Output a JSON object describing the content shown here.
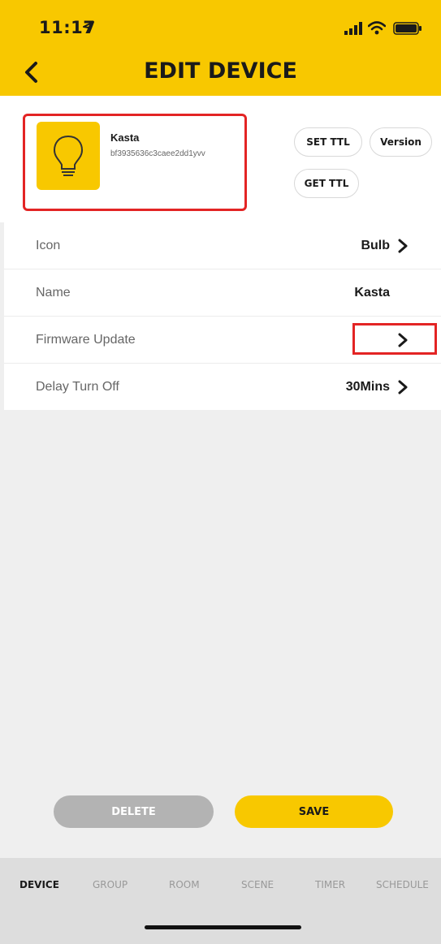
{
  "status_bar": {
    "time": "11:17"
  },
  "header": {
    "title": "EDIT DEVICE"
  },
  "device": {
    "name": "Kasta",
    "id": "bf3935636c3caee2dd1yvv",
    "actions": {
      "set_ttl": "SET TTL",
      "version": "Version",
      "get_ttl": "GET TTL"
    }
  },
  "settings": [
    {
      "label": "Icon",
      "value": "Bulb",
      "chevron": true
    },
    {
      "label": "Name",
      "value": "Kasta",
      "chevron": false
    },
    {
      "label": "Firmware Update",
      "value": "",
      "chevron": true
    },
    {
      "label": "Delay Turn Off",
      "value": "30Mins",
      "chevron": true
    }
  ],
  "buttons": {
    "delete": "DELETE",
    "save": "SAVE"
  },
  "tabs": [
    "DEVICE",
    "GROUP",
    "ROOM",
    "SCENE",
    "TIMER",
    "SCHEDULE"
  ],
  "active_tab": "DEVICE",
  "colors": {
    "accent": "#f8c800",
    "highlight": "#e32424",
    "disabled": "#b3b3b3"
  },
  "icons": {
    "device_tile": "lightbulb-icon",
    "back": "back-chevron-icon"
  }
}
